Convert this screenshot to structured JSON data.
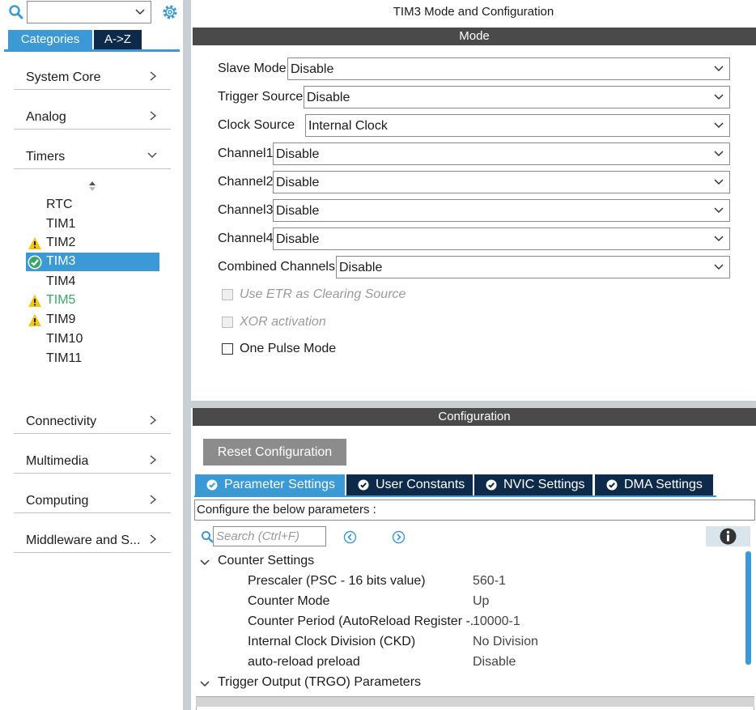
{
  "left": {
    "search_value": "",
    "tabs": {
      "categories": "Categories",
      "az": "A->Z"
    },
    "categories": [
      {
        "label": "System Core"
      },
      {
        "label": "Analog"
      },
      {
        "label": "Timers"
      },
      {
        "label": "Connectivity"
      },
      {
        "label": "Multimedia"
      },
      {
        "label": "Computing"
      },
      {
        "label": "Middleware and S..."
      }
    ],
    "timers": [
      {
        "label": "RTC",
        "status": "none"
      },
      {
        "label": "TIM1",
        "status": "none"
      },
      {
        "label": "TIM2",
        "status": "warning"
      },
      {
        "label": "TIM3",
        "status": "ok",
        "selected": true
      },
      {
        "label": "TIM4",
        "status": "none"
      },
      {
        "label": "TIM5",
        "status": "warning",
        "color": "#3ca56a"
      },
      {
        "label": "TIM9",
        "status": "warning"
      },
      {
        "label": "TIM10",
        "status": "none"
      },
      {
        "label": "TIM11",
        "status": "none"
      }
    ]
  },
  "main": {
    "title": "TIM3 Mode and Configuration",
    "mode_header": "Mode",
    "mode_rows": [
      {
        "label": "Slave Mode",
        "value": "Disable"
      },
      {
        "label": "Trigger Source",
        "value": "Disable"
      },
      {
        "label": "Clock Source",
        "value": "Internal Clock"
      },
      {
        "label": "Channel1",
        "value": "Disable"
      },
      {
        "label": "Channel2",
        "value": "Disable"
      },
      {
        "label": "Channel3",
        "value": "Disable"
      },
      {
        "label": "Channel4",
        "value": "Disable"
      },
      {
        "label": "Combined Channels",
        "value": "Disable"
      }
    ],
    "checkboxes": [
      {
        "label": "Use ETR as Clearing Source",
        "enabled": false,
        "checked": false
      },
      {
        "label": "XOR activation",
        "enabled": false,
        "checked": false
      },
      {
        "label": "One Pulse Mode",
        "enabled": true,
        "checked": false
      }
    ],
    "config_header": "Configuration",
    "reset_label": "Reset Configuration",
    "config_tabs": [
      {
        "label": "Parameter Settings",
        "active": true
      },
      {
        "label": "User Constants"
      },
      {
        "label": "NVIC Settings"
      },
      {
        "label": "DMA Settings"
      }
    ],
    "configure_text": "Configure the below parameters :",
    "search_placeholder": "Search (Ctrl+F)",
    "groups": [
      {
        "label": "Counter Settings",
        "params": [
          {
            "key": "Prescaler (PSC - 16 bits value)",
            "value": "560-1"
          },
          {
            "key": "Counter Mode",
            "value": "Up"
          },
          {
            "key": "Counter Period (AutoReload Register -...",
            "value": "10000-1"
          },
          {
            "key": "Internal Clock Division (CKD)",
            "value": "No Division"
          },
          {
            "key": "auto-reload preload",
            "value": "Disable"
          }
        ]
      },
      {
        "label": "Trigger Output (TRGO) Parameters",
        "params": []
      }
    ]
  },
  "colors": {
    "accent": "#3b9ad6",
    "dark_tab": "#0e2a4a",
    "header_bar": "#4a4a4a",
    "warning": "#f2c511",
    "ok": "#3ca56a"
  }
}
